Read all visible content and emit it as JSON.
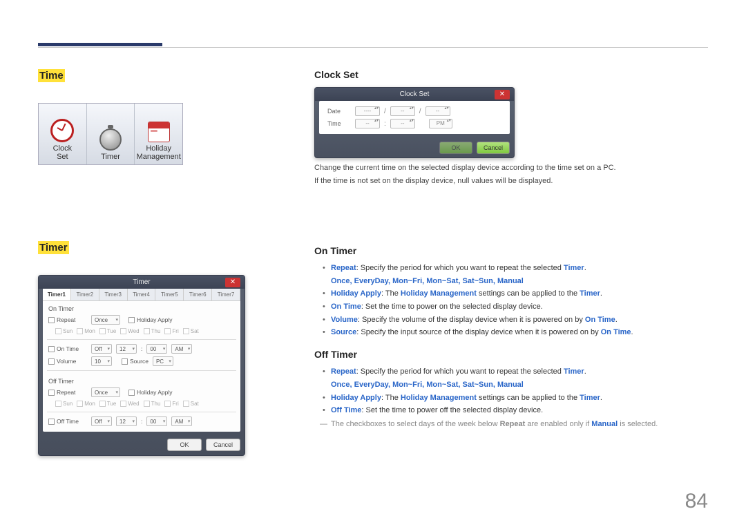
{
  "page_number": "84",
  "left": {
    "time_heading": "Time",
    "tiles": {
      "clock": "Clock\nSet",
      "timer": "Timer",
      "holiday": "Holiday\nManagement"
    },
    "timer_heading": "Timer",
    "timer_dlg": {
      "title": "Timer",
      "tabs": [
        "Timer1",
        "Timer2",
        "Timer3",
        "Timer4",
        "Timer5",
        "Timer6",
        "Timer7"
      ],
      "on_timer": "On Timer",
      "repeat": "Repeat",
      "once": "Once",
      "holiday_apply": "Holiday Apply",
      "days": [
        "Sun",
        "Mon",
        "Tue",
        "Wed",
        "Thu",
        "Fri",
        "Sat"
      ],
      "on_time": "On Time",
      "off": "Off",
      "twelve": "12",
      "zero": "00",
      "am": "AM",
      "volume": "Volume",
      "vol_val": "10",
      "source": "Source",
      "pc": "PC",
      "off_timer": "Off Timer",
      "off_time": "Off Time",
      "ok": "OK",
      "cancel": "Cancel"
    }
  },
  "right": {
    "clockset": {
      "heading": "Clock Set",
      "dlg_title": "Clock Set",
      "date": "Date",
      "time": "Time",
      "pm": "PM",
      "dash": "----",
      "ddash": "--",
      "ok": "OK",
      "cancel": "Cancel",
      "desc1": "Change the current time on the selected display device according to the time set on a PC.",
      "desc2": "If the time is not set on the display device, null values will be displayed."
    },
    "ontimer": {
      "heading": "On Timer",
      "b1_a": "Repeat",
      "b1_b": ": Specify the period for which you want to repeat the selected ",
      "b1_c": "Timer",
      "b1_d": ".",
      "options": "Once, EveryDay, Mon~Fri, Mon~Sat, Sat~Sun, Manual",
      "b2_a": "Holiday Apply",
      "b2_b": ": The ",
      "b2_c": "Holiday Management",
      "b2_d": " settings can be applied to the ",
      "b2_e": "Timer",
      "b2_f": ".",
      "b3_a": "On Time",
      "b3_b": ": Set the time to power on the selected display device.",
      "b4_a": "Volume",
      "b4_b": ": Specify the volume of the display device when it is powered on by ",
      "b4_c": "On Time",
      "b4_d": ".",
      "b5_a": "Source",
      "b5_b": ": Specify the input source of the display device when it is powered on by ",
      "b5_c": "On Time",
      "b5_d": "."
    },
    "offtimer": {
      "heading": "Off Timer",
      "b1_a": "Repeat",
      "b1_b": ": Specify the period for which you want to repeat the selected ",
      "b1_c": "Timer",
      "b1_d": ".",
      "options": "Once, EveryDay, Mon~Fri, Mon~Sat, Sat~Sun, Manual",
      "b2_a": "Holiday Apply",
      "b2_b": ": The ",
      "b2_c": "Holiday Management",
      "b2_d": " settings can be applied to the ",
      "b2_e": "Timer",
      "b2_f": ".",
      "b3_a": "Off Time",
      "b3_b": ": Set the time to power off the selected display device.",
      "note_a": "The checkboxes to select days of the week below ",
      "note_b": "Repeat",
      "note_c": " are enabled only if ",
      "note_d": "Manual",
      "note_e": " is selected."
    }
  }
}
